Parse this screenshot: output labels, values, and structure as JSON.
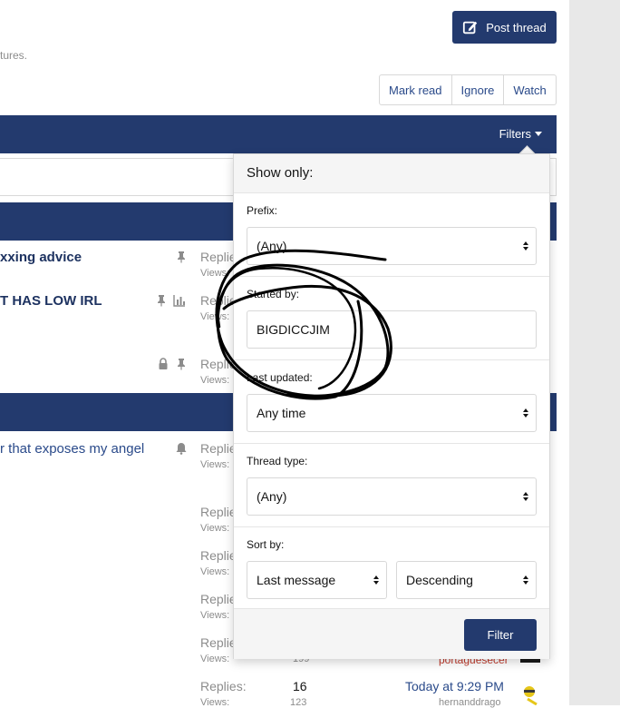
{
  "header": {
    "post_thread_label": "Post thread",
    "description_tail": "tures."
  },
  "actions": {
    "mark_read": "Mark read",
    "ignore": "Ignore",
    "watch": "Watch"
  },
  "filter_bar": {
    "filters_label": "Filters"
  },
  "threads": {
    "row1_title": "xxing advice",
    "row2_title": "T HAS LOW IRL",
    "row4_title": "r that exposes my angel",
    "replies_label": "Replies",
    "replies_label_full": "Replies:",
    "views_label": "Views:",
    "last_row_replies": "16",
    "last_row_views": "123",
    "last_row_date": "Today at 9:29 PM",
    "last_row_user": "hernanddrago",
    "red_user": "portaguesecer",
    "views_red_row": "199"
  },
  "filter_menu": {
    "header": "Show only:",
    "prefix_label": "Prefix:",
    "prefix_value": "(Any)",
    "started_by_label": "Started by:",
    "started_by_value": "BIGDICCJIM",
    "last_updated_label": "Last updated:",
    "last_updated_value": "Any time",
    "thread_type_label": "Thread type:",
    "thread_type_value": "(Any)",
    "sort_by_label": "Sort by:",
    "sort_field_value": "Last message",
    "sort_direction_value": "Descending",
    "submit_label": "Filter"
  },
  "colors": {
    "primary": "#233a6e",
    "link": "#2a4a8a",
    "muted": "#8c8c8c"
  }
}
